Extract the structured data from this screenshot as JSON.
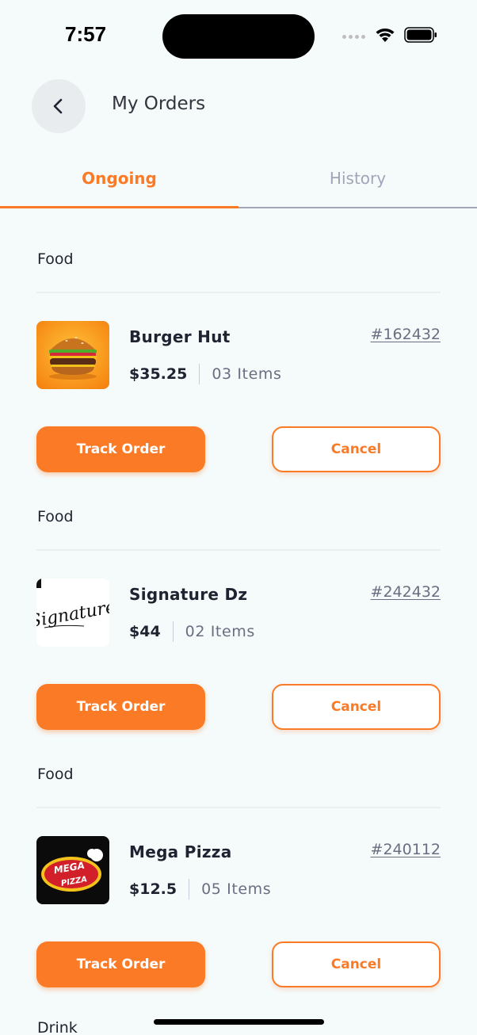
{
  "status_bar": {
    "time": "7:57"
  },
  "header": {
    "title": "My Orders",
    "back_icon": "chevron-left-icon"
  },
  "tabs": [
    {
      "label": "Ongoing",
      "active": true
    },
    {
      "label": "History",
      "active": false
    }
  ],
  "colors": {
    "accent": "#fb7a26",
    "inactive_tab": "#a0a5ba",
    "background": "#f5fafa"
  },
  "orders": [
    {
      "category": "Food",
      "restaurant": "Burger Hut",
      "order_id": "#162432",
      "price": "$35.25",
      "items": "03 Items",
      "thumb": "burger-image",
      "track_label": "Track Order",
      "cancel_label": "Cancel"
    },
    {
      "category": "Food",
      "restaurant": "Signature Dz",
      "order_id": "#242432",
      "price": "$44",
      "items": "02 Items",
      "thumb": "signature-logo",
      "logo_text": "Signature",
      "track_label": "Track Order",
      "cancel_label": "Cancel"
    },
    {
      "category": "Food",
      "restaurant": "Mega Pizza",
      "order_id": "#240112",
      "price": "$12.5",
      "items": "05 Items",
      "thumb": "mega-pizza-logo",
      "logo_text": "MEGA PIZZA",
      "track_label": "Track Order",
      "cancel_label": "Cancel"
    }
  ],
  "next_category": "Drink"
}
